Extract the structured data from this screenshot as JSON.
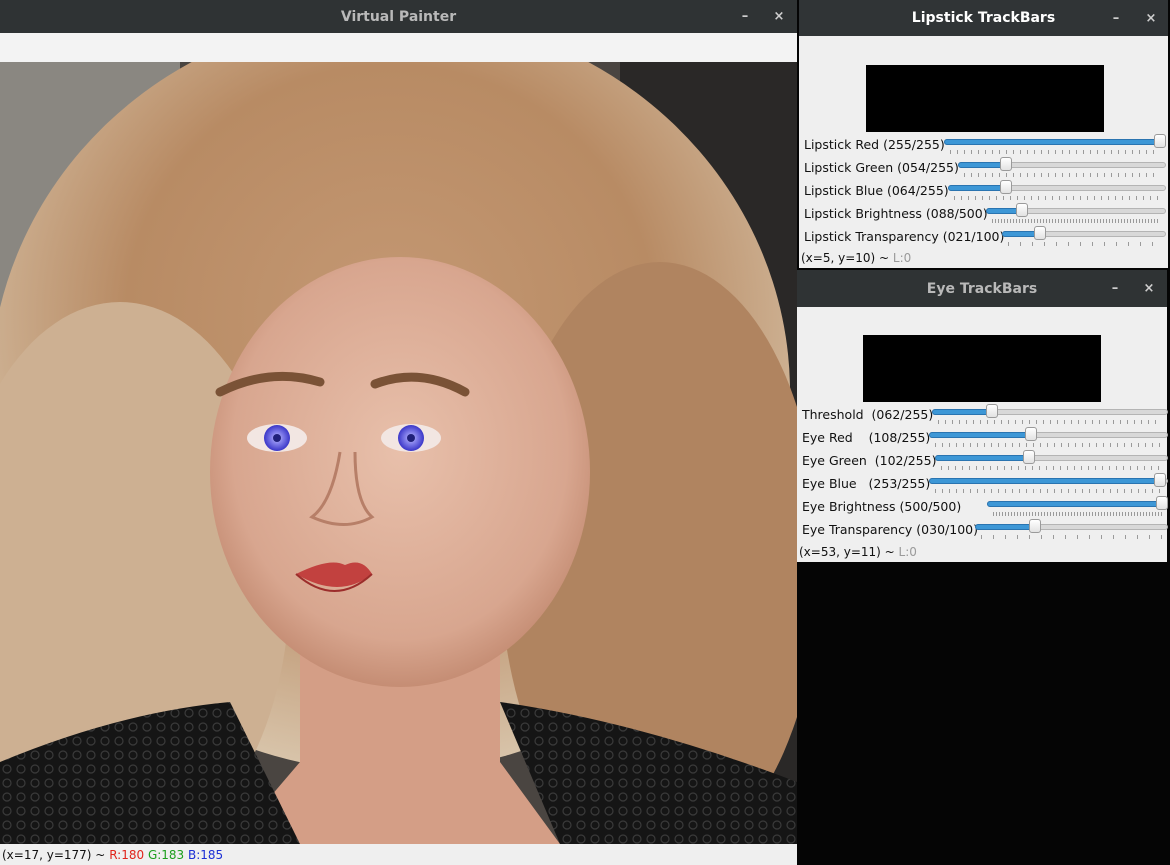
{
  "painter": {
    "title": "Virtual Painter",
    "minimize_glyph": "–",
    "close_glyph": "×",
    "status": {
      "coords": "(x=17, y=177) ~",
      "r": "R:180",
      "g": "G:183",
      "b": "B:185"
    },
    "colors": {
      "r": "#e0241b",
      "g": "#1b9e1b",
      "b": "#1b2fd6"
    }
  },
  "lipstick": {
    "title": "Lipstick TrackBars",
    "minimize_glyph": "–",
    "close_glyph": "×",
    "preview_color": "#000000",
    "status_coords": "(x=5, y=10) ~",
    "status_level": "L:0",
    "sliders": [
      {
        "label": "Lipstick Red (255/255)",
        "value": 255,
        "max": 255
      },
      {
        "label": "Lipstick Green (054/255)",
        "value": 54,
        "max": 255
      },
      {
        "label": "Lipstick Blue (064/255)",
        "value": 64,
        "max": 255
      },
      {
        "label": "Lipstick Brightness (088/500)",
        "value": 88,
        "max": 500
      },
      {
        "label": "Lipstick Transparency (021/100)",
        "value": 21,
        "max": 100
      }
    ]
  },
  "eye": {
    "title": "Eye TrackBars",
    "minimize_glyph": "–",
    "close_glyph": "×",
    "preview_color": "#000000",
    "status_coords": "(x=53, y=11) ~",
    "status_level": "L:0",
    "sliders": [
      {
        "label": "Threshold  (062/255)",
        "value": 62,
        "max": 255
      },
      {
        "label": "Eye Red    (108/255)",
        "value": 108,
        "max": 255
      },
      {
        "label": "Eye Green  (102/255)",
        "value": 102,
        "max": 255
      },
      {
        "label": "Eye Blue   (253/255)",
        "value": 253,
        "max": 255
      },
      {
        "label": "Eye Brightness (500/500)",
        "value": 500,
        "max": 500
      },
      {
        "label": "Eye Transparency (030/100)",
        "value": 30,
        "max": 100
      }
    ]
  },
  "accent": "#3d97d6"
}
